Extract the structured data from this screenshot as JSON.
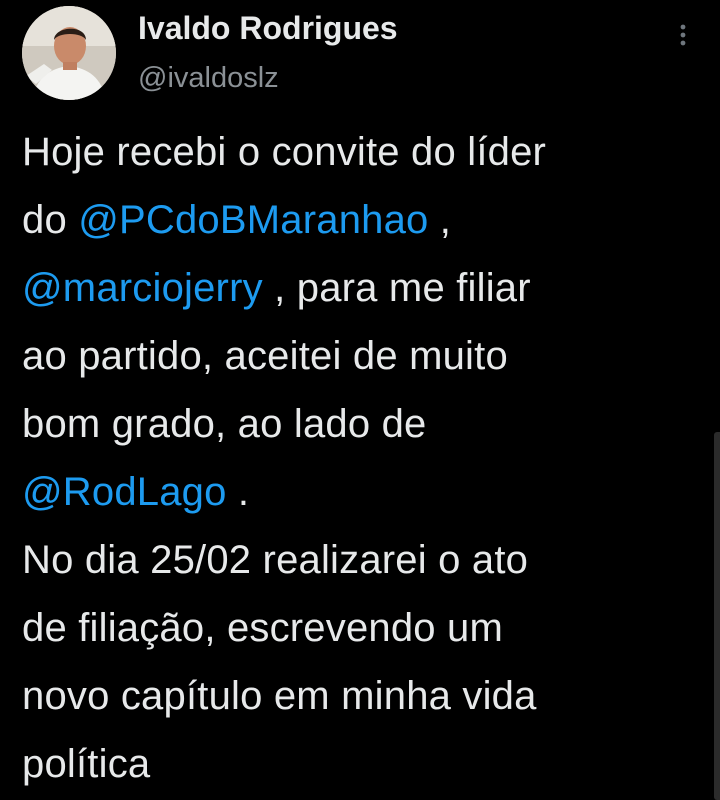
{
  "author": {
    "name": "Ivaldo Rodrigues",
    "handle": "@ivaldoslz",
    "avatar_icon": "profile-photo"
  },
  "menu": {
    "icon": "more-vertical-icon"
  },
  "tweet": {
    "lines": [
      {
        "parts": [
          {
            "text": "Hoje recebi o convite do líder",
            "mention": false
          }
        ]
      },
      {
        "parts": [
          {
            "text": "do ",
            "mention": false
          },
          {
            "text": "@PCdoBMaranhao",
            "mention": true
          },
          {
            "text": " ,",
            "mention": false
          }
        ]
      },
      {
        "parts": [
          {
            "text": "@marciojerry",
            "mention": true
          },
          {
            "text": " , para me filiar",
            "mention": false
          }
        ]
      },
      {
        "parts": [
          {
            "text": "ao partido, aceitei de muito",
            "mention": false
          }
        ]
      },
      {
        "parts": [
          {
            "text": "bom grado, ao lado de",
            "mention": false
          }
        ]
      },
      {
        "parts": [
          {
            "text": "@RodLago",
            "mention": true
          },
          {
            "text": " .",
            "mention": false
          }
        ]
      },
      {
        "parts": [
          {
            "text": "No dia 25/02 realizarei o ato",
            "mention": false
          }
        ]
      },
      {
        "parts": [
          {
            "text": "de filiação, escrevendo um",
            "mention": false
          }
        ]
      },
      {
        "parts": [
          {
            "text": "novo capítulo em minha vida",
            "mention": false
          }
        ]
      },
      {
        "parts": [
          {
            "text": "política",
            "mention": false
          }
        ]
      }
    ]
  },
  "colors": {
    "background": "#000000",
    "text": "#e7e9ea",
    "secondary_text": "#8b9196",
    "mention": "#1d9bf0"
  }
}
